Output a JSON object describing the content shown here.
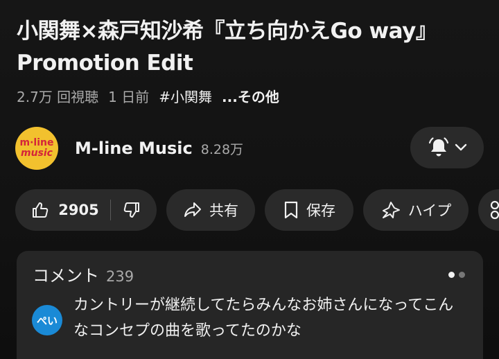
{
  "video": {
    "title": "小関舞×森戸知沙希『立ち向かえGo way』Promotion Edit",
    "views": "2.7万 回視聴",
    "age": "1 日前",
    "hashtag": "#小関舞",
    "more_label": "...その他"
  },
  "channel": {
    "avatar_line1": "m·line",
    "avatar_line2": "music",
    "name": "M-line Music",
    "subscribers": "8.28万"
  },
  "actions": {
    "like_count": "2905",
    "share_label": "共有",
    "save_label": "保存",
    "hype_label": "ハイプ"
  },
  "comments": {
    "title": "コメント",
    "count": "239",
    "top_comment": {
      "avatar_text": "ぺい",
      "text": "カントリーが継続してたらみんなお姉さんになってこんなコンセプの曲を歌ってたのかな"
    }
  },
  "colors": {
    "background": "#121212",
    "pill": "#2a2a2a",
    "channel_avatar": "#f2c12e",
    "comment_avatar": "#1a8ad6"
  }
}
